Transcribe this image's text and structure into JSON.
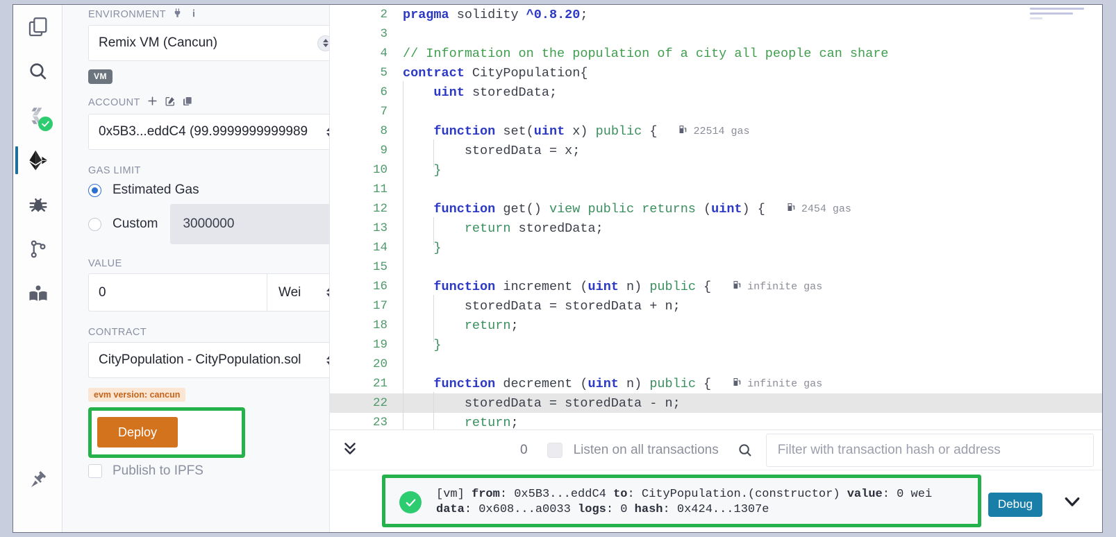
{
  "app": {
    "name": "Remix IDE - Deploy & Run Transactions"
  },
  "rail": {
    "items": [
      {
        "name": "file-explorer",
        "icon": "files-icon",
        "active": false,
        "badge": null
      },
      {
        "name": "search",
        "icon": "search-icon",
        "active": false,
        "badge": null
      },
      {
        "name": "solidity-compiler",
        "icon": "compiler-icon",
        "active": false,
        "badge": "check"
      },
      {
        "name": "deploy-run-transactions",
        "icon": "ethereum-icon",
        "active": true,
        "badge": null
      },
      {
        "name": "debugger",
        "icon": "bug-icon",
        "active": false,
        "badge": null
      },
      {
        "name": "git",
        "icon": "git-branch-icon",
        "active": false,
        "badge": null
      },
      {
        "name": "learneth",
        "icon": "book-icon",
        "active": false,
        "badge": null
      }
    ],
    "bottom": {
      "name": "plugin-manager",
      "icon": "plug-icon"
    }
  },
  "panel": {
    "environment": {
      "label": "ENVIRONMENT",
      "plug_icon": "plug-icon",
      "info_icon": "info-icon",
      "value": "Remix VM (Cancun)",
      "chip": "VM"
    },
    "account": {
      "label": "ACCOUNT",
      "add_icon": "plus-icon",
      "edit_icon": "edit-icon",
      "copy_icon": "copy-icon",
      "value": "0x5B3...eddC4 (99.9999999999989"
    },
    "gas_limit": {
      "label": "GAS LIMIT",
      "estimated_label": "Estimated Gas",
      "estimated_selected": true,
      "custom_label": "Custom",
      "custom_selected": false,
      "custom_value": "3000000"
    },
    "value": {
      "label": "VALUE",
      "amount": "0",
      "unit": "Wei"
    },
    "contract": {
      "label": "CONTRACT",
      "value": "CityPopulation - CityPopulation.sol",
      "evm_chip": "evm version: cancun"
    },
    "deploy": {
      "button_label": "Deploy",
      "highlight_color": "#25b14c",
      "button_color": "#d3731e"
    },
    "ipfs": {
      "label": "Publish to IPFS",
      "checked": false
    }
  },
  "editor": {
    "lines": [
      {
        "n": "2",
        "indent": 0,
        "tokens": [
          {
            "t": "pragma",
            "c": "kw"
          },
          {
            "t": " solidity ",
            "c": "id"
          },
          {
            "t": "^0.8.20",
            "c": "num"
          },
          {
            "t": ";",
            "c": "pun"
          }
        ],
        "gas": null,
        "hl": false
      },
      {
        "n": "3",
        "indent": 0,
        "tokens": [],
        "gas": null,
        "hl": false
      },
      {
        "n": "4",
        "indent": 0,
        "tokens": [
          {
            "t": "// Information on the population of a city all people can share",
            "c": "cmt"
          }
        ],
        "gas": null,
        "hl": false
      },
      {
        "n": "5",
        "indent": 0,
        "tokens": [
          {
            "t": "contract",
            "c": "kw"
          },
          {
            "t": " CityPopulation{",
            "c": "id"
          }
        ],
        "gas": null,
        "hl": false
      },
      {
        "n": "6",
        "indent": 1,
        "tokens": [
          {
            "t": "    ",
            "c": "pun"
          },
          {
            "t": "uint",
            "c": "type"
          },
          {
            "t": " storedData;",
            "c": "id"
          }
        ],
        "gas": null,
        "hl": false
      },
      {
        "n": "7",
        "indent": 1,
        "tokens": [],
        "gas": null,
        "hl": false
      },
      {
        "n": "8",
        "indent": 1,
        "tokens": [
          {
            "t": "    ",
            "c": "pun"
          },
          {
            "t": "function",
            "c": "kw"
          },
          {
            "t": " set(",
            "c": "id"
          },
          {
            "t": "uint",
            "c": "type"
          },
          {
            "t": " x) ",
            "c": "id"
          },
          {
            "t": "public",
            "c": "kw2"
          },
          {
            "t": " {",
            "c": "pun"
          }
        ],
        "gas": "22514 gas",
        "hl": false
      },
      {
        "n": "9",
        "indent": 2,
        "tokens": [
          {
            "t": "        storedData = x;",
            "c": "id"
          }
        ],
        "gas": null,
        "hl": false
      },
      {
        "n": "10",
        "indent": 1,
        "tokens": [
          {
            "t": "    }",
            "c": "kw2"
          }
        ],
        "gas": null,
        "hl": false
      },
      {
        "n": "11",
        "indent": 1,
        "tokens": [],
        "gas": null,
        "hl": false
      },
      {
        "n": "12",
        "indent": 1,
        "tokens": [
          {
            "t": "    ",
            "c": "pun"
          },
          {
            "t": "function",
            "c": "kw"
          },
          {
            "t": " get() ",
            "c": "id"
          },
          {
            "t": "view public returns",
            "c": "kw2"
          },
          {
            "t": " (",
            "c": "pun"
          },
          {
            "t": "uint",
            "c": "type"
          },
          {
            "t": ") {",
            "c": "pun"
          }
        ],
        "gas": "2454 gas",
        "hl": false
      },
      {
        "n": "13",
        "indent": 2,
        "tokens": [
          {
            "t": "        ",
            "c": "pun"
          },
          {
            "t": "return",
            "c": "kw2"
          },
          {
            "t": " storedData;",
            "c": "id"
          }
        ],
        "gas": null,
        "hl": false
      },
      {
        "n": "14",
        "indent": 1,
        "tokens": [
          {
            "t": "    }",
            "c": "kw2"
          }
        ],
        "gas": null,
        "hl": false
      },
      {
        "n": "15",
        "indent": 1,
        "tokens": [],
        "gas": null,
        "hl": false
      },
      {
        "n": "16",
        "indent": 1,
        "tokens": [
          {
            "t": "    ",
            "c": "pun"
          },
          {
            "t": "function",
            "c": "kw"
          },
          {
            "t": " increment (",
            "c": "id"
          },
          {
            "t": "uint",
            "c": "type"
          },
          {
            "t": " n) ",
            "c": "id"
          },
          {
            "t": "public",
            "c": "kw2"
          },
          {
            "t": " {",
            "c": "pun"
          }
        ],
        "gas": "infinite gas",
        "hl": false
      },
      {
        "n": "17",
        "indent": 2,
        "tokens": [
          {
            "t": "        storedData = storedData + n;",
            "c": "id"
          }
        ],
        "gas": null,
        "hl": false
      },
      {
        "n": "18",
        "indent": 2,
        "tokens": [
          {
            "t": "        ",
            "c": "pun"
          },
          {
            "t": "return",
            "c": "kw2"
          },
          {
            "t": ";",
            "c": "pun"
          }
        ],
        "gas": null,
        "hl": false
      },
      {
        "n": "19",
        "indent": 1,
        "tokens": [
          {
            "t": "    }",
            "c": "kw2"
          }
        ],
        "gas": null,
        "hl": false
      },
      {
        "n": "20",
        "indent": 1,
        "tokens": [],
        "gas": null,
        "hl": false
      },
      {
        "n": "21",
        "indent": 1,
        "tokens": [
          {
            "t": "    ",
            "c": "pun"
          },
          {
            "t": "function",
            "c": "kw"
          },
          {
            "t": " decrement (",
            "c": "id"
          },
          {
            "t": "uint",
            "c": "type"
          },
          {
            "t": " n) ",
            "c": "id"
          },
          {
            "t": "public",
            "c": "kw2"
          },
          {
            "t": " {",
            "c": "pun"
          }
        ],
        "gas": "infinite gas",
        "hl": false
      },
      {
        "n": "22",
        "indent": 2,
        "tokens": [
          {
            "t": "        storedData = storedData - n;",
            "c": "id"
          }
        ],
        "gas": null,
        "hl": true
      },
      {
        "n": "23",
        "indent": 2,
        "tokens": [
          {
            "t": "        ",
            "c": "pun"
          },
          {
            "t": "return",
            "c": "kw2"
          },
          {
            "t": ";",
            "c": "pun"
          }
        ],
        "gas": null,
        "hl": false
      }
    ]
  },
  "terminal": {
    "collapse_icon": "chevron-double-down-icon",
    "count": "0",
    "listen_label": "Listen on all transactions",
    "listen_checked": false,
    "search_icon": "search-icon",
    "filter_placeholder": "Filter with transaction hash or address",
    "filter_value": "",
    "transaction": {
      "status_icon": "check-circle-icon",
      "line1": "[vm] from: 0x5B3...eddC4 to: CityPopulation.(constructor) value: 0 wei",
      "line2": "data: 0x608...a0033 logs: 0 hash: 0x424...1307e",
      "line1_parts": [
        {
          "t": "[vm] ",
          "b": false
        },
        {
          "t": "from",
          "b": true
        },
        {
          "t": ": 0x5B3...eddC4 ",
          "b": false
        },
        {
          "t": "to",
          "b": true
        },
        {
          "t": ": CityPopulation.(constructor) ",
          "b": false
        },
        {
          "t": "value",
          "b": true
        },
        {
          "t": ": 0 wei",
          "b": false
        }
      ],
      "line2_parts": [
        {
          "t": "data",
          "b": true
        },
        {
          "t": ": 0x608...a0033 ",
          "b": false
        },
        {
          "t": "logs",
          "b": true
        },
        {
          "t": ": 0 ",
          "b": false
        },
        {
          "t": "hash",
          "b": true
        },
        {
          "t": ": 0x424...1307e",
          "b": false
        }
      ],
      "debug_label": "Debug",
      "expand_icon": "chevron-down-icon",
      "highlight_color": "#25b14c"
    }
  }
}
